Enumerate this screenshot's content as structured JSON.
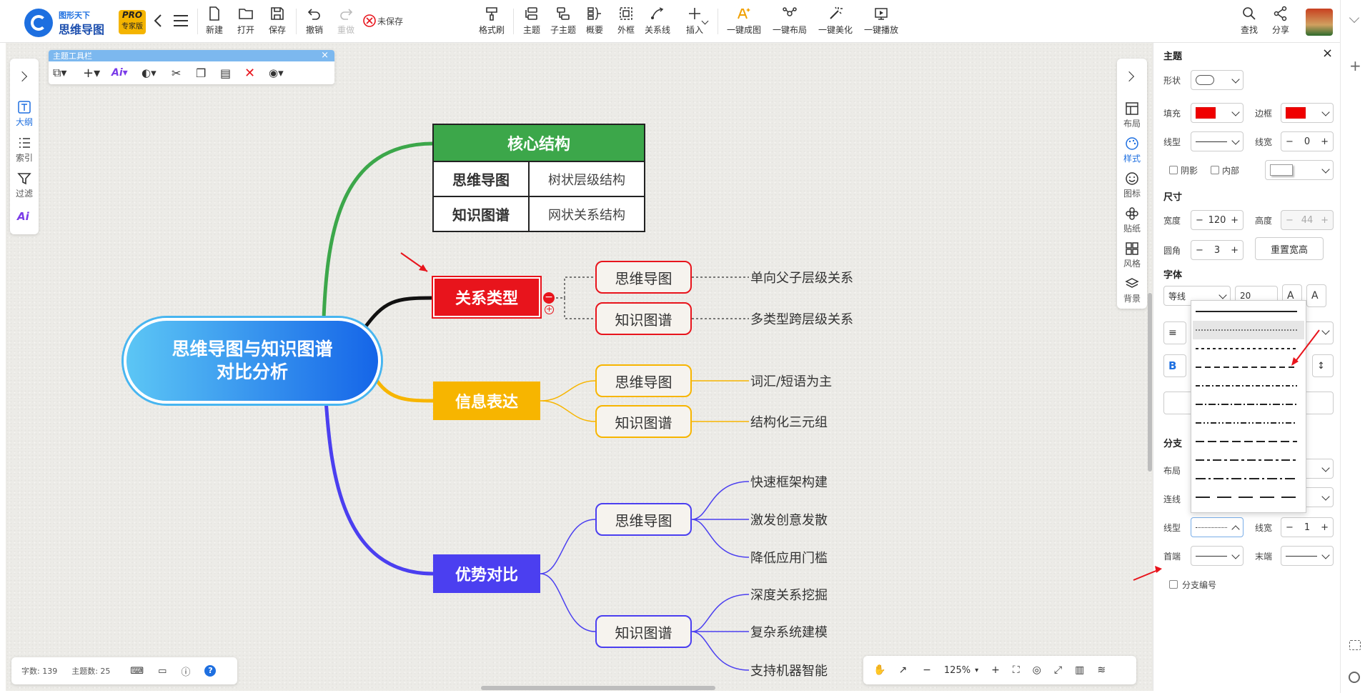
{
  "app": {
    "brand_top": "图形天下",
    "brand_name": "思维导图",
    "badge_top": "PRO",
    "badge_bottom": "专家版",
    "unsaved": "未保存"
  },
  "toolbar": {
    "file": [
      "新建",
      "打开",
      "保存"
    ],
    "undo": "撤销",
    "redo": "重做",
    "format_brush": "格式刷",
    "insert": [
      "主题",
      "子主题",
      "概要",
      "外框",
      "关系线",
      "插入"
    ],
    "magic": [
      "一键成图",
      "一键布局",
      "一键美化",
      "一键播放"
    ],
    "right": [
      "查找",
      "分享"
    ]
  },
  "float_toolbar": {
    "title": "主题工具栏"
  },
  "left_sidebar": [
    "大纲",
    "索引",
    "过滤"
  ],
  "right_sidebar": [
    "布局",
    "样式",
    "图标",
    "贴纸",
    "风格",
    "背景"
  ],
  "mindmap": {
    "root": "思维导图与知识图谱\n对比分析",
    "table": {
      "header": "核心结构",
      "rows": [
        [
          "思维导图",
          "树状层级结构"
        ],
        [
          "知识图谱",
          "网状关系结构"
        ]
      ]
    },
    "branches": [
      {
        "label": "关系类型",
        "children": [
          {
            "label": "思维导图",
            "leaves": [
              "单向父子层级关系"
            ]
          },
          {
            "label": "知识图谱",
            "leaves": [
              "多类型跨层级关系"
            ]
          }
        ]
      },
      {
        "label": "信息表达",
        "children": [
          {
            "label": "思维导图",
            "leaves": [
              "词汇/短语为主"
            ]
          },
          {
            "label": "知识图谱",
            "leaves": [
              "结构化三元组"
            ]
          }
        ]
      },
      {
        "label": "优势对比",
        "children": [
          {
            "label": "思维导图",
            "leaves": [
              "快速框架构建",
              "激发创意发散",
              "降低应用门槛"
            ]
          },
          {
            "label": "知识图谱",
            "leaves": [
              "深度关系挖掘",
              "复杂系统建模",
              "支持机器智能"
            ]
          }
        ]
      }
    ]
  },
  "status": {
    "word_count": "字数: 139",
    "topic_count": "主题数: 25"
  },
  "zoom": {
    "value": "125%"
  },
  "panel": {
    "title": "主题",
    "shape": "形状",
    "fill": "填充",
    "border": "边框",
    "line_type": "线型",
    "line_width": "线宽",
    "line_width_value": "0",
    "shadow": "阴影",
    "inner": "内部",
    "size": "尺寸",
    "width": "宽度",
    "width_value": "120",
    "height": "高度",
    "height_value": "44",
    "radius": "圆角",
    "radius_value": "3",
    "reset_size": "重置宽高",
    "font": "字体",
    "font_name": "等线",
    "font_size": "20",
    "branch": "分支",
    "layout": "布局",
    "connector": "连线",
    "branch_line_type": "线型",
    "branch_line_width": "线宽",
    "branch_line_width_value": "1",
    "head": "首端",
    "tail": "末端",
    "branch_number": "分支编号"
  },
  "colors": {
    "root_start": "#5cc6f5",
    "root_end": "#1565e8",
    "red": "#e8141c",
    "orange": "#f7b500",
    "blue": "#4b3ff0",
    "green": "#3ca74a",
    "table_header": "#3ca74a"
  }
}
